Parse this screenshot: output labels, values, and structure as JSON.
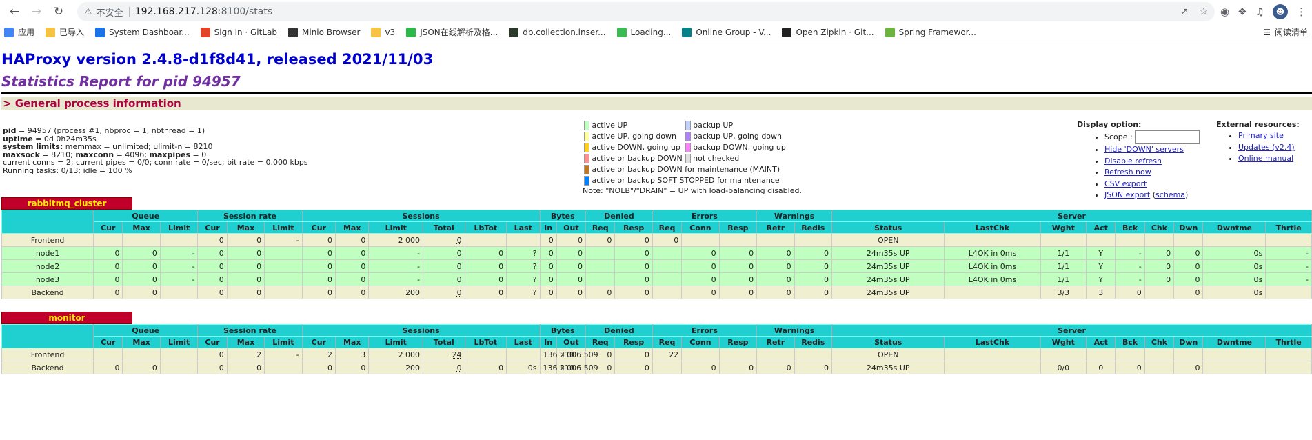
{
  "browser": {
    "insecure_label": "不安全",
    "url_host": "192.168.217.128",
    "url_path": ":8100/stats",
    "bookmarks": [
      {
        "label": "应用",
        "icon": "apps-grid-icon",
        "color": "#4285f4"
      },
      {
        "label": "已导入",
        "icon": "folder-icon",
        "color": "#f6c343"
      },
      {
        "label": "System Dashboar...",
        "icon": "diamond-icon",
        "color": "#1a73e8"
      },
      {
        "label": "Sign in · GitLab",
        "icon": "gitlab-icon",
        "color": "#e24329"
      },
      {
        "label": "Minio Browser",
        "icon": "minio-icon",
        "color": "#333333"
      },
      {
        "label": "v3",
        "icon": "folder-icon",
        "color": "#f6c343"
      },
      {
        "label": "JSON在线解析及格...",
        "icon": "json-icon",
        "color": "#2db84b"
      },
      {
        "label": "db.collection.inser...",
        "icon": "mongo-icon",
        "color": "#2b3a2b"
      },
      {
        "label": "Loading...",
        "icon": "play-icon",
        "color": "#3cba54"
      },
      {
        "label": "Online Group - V...",
        "icon": "sharepoint-icon",
        "color": "#038387"
      },
      {
        "label": "Open Zipkin · Git...",
        "icon": "github-icon",
        "color": "#222222"
      },
      {
        "label": "Spring Framewor...",
        "icon": "spring-icon",
        "color": "#6db33f"
      }
    ],
    "reading_list": "阅读清单"
  },
  "header": {
    "title": "HAProxy version 2.4.8-d1f8d41, released 2021/11/03",
    "subtitle": "Statistics Report for pid 94957",
    "section": "> General process information"
  },
  "info": {
    "pid_label": "pid",
    "pid_value": " = 94957 (process #1, nbproc = 1, nbthread = 1)",
    "uptime_label": "uptime",
    "uptime_value": " = 0d 0h24m35s",
    "limits_label": "system limits:",
    "limits_value": " memmax = unlimited; ulimit-n = 8210",
    "maxsock_label": "maxsock",
    "maxsock_value": " = 8210; ",
    "maxconn_label": "maxconn",
    "maxconn_value": " = 4096; ",
    "maxpipes_label": "maxpipes",
    "maxpipes_value": " = 0",
    "conns": "current conns = 2; current pipes = 0/0; conn rate = 0/sec; bit rate = 0.000 kbps",
    "tasks": "Running tasks: 0/13; idle = 100 %"
  },
  "legend": {
    "items_left": [
      {
        "label": "active UP",
        "color": "#c0ffc0"
      },
      {
        "label": "active UP, going down",
        "color": "#ffffa0"
      },
      {
        "label": "active DOWN, going up",
        "color": "#ffd020"
      },
      {
        "label": "active or backup DOWN",
        "color": "#ff9090"
      },
      {
        "label": "active or backup DOWN for maintenance (MAINT)",
        "color": "#c07820"
      },
      {
        "label": "active or backup SOFT STOPPED for maintenance",
        "color": "#0080ff"
      }
    ],
    "items_right": [
      {
        "label": "backup UP",
        "color": "#c0d0ff"
      },
      {
        "label": "backup UP, going down",
        "color": "#b080ff"
      },
      {
        "label": "backup DOWN, going up",
        "color": "#ff80ff"
      },
      {
        "label": "not checked",
        "color": "#e0e0e0"
      }
    ],
    "note": "Note: \"NOLB\"/\"DRAIN\" = UP with load-balancing disabled."
  },
  "display": {
    "title": "Display option:",
    "scope_label": "Scope :",
    "links": [
      "Hide 'DOWN' servers",
      "Disable refresh",
      "Refresh now",
      "CSV export",
      "JSON export"
    ],
    "schema_label": "schema"
  },
  "external": {
    "title": "External resources:",
    "links": [
      "Primary site",
      "Updates (v2.4)",
      "Online manual"
    ]
  },
  "proxies": [
    {
      "name": "rabbitmq_cluster",
      "groups": [
        "Queue",
        "Session rate",
        "Sessions",
        "Bytes",
        "Denied",
        "Errors",
        "Warnings",
        "Server"
      ],
      "subheaders": [
        "Cur",
        "Max",
        "Limit",
        "Cur",
        "Max",
        "Limit",
        "Cur",
        "Max",
        "Limit",
        "Total",
        "LbTot",
        "Last",
        "In",
        "Out",
        "Req",
        "Resp",
        "Req",
        "Conn",
        "Resp",
        "Retr",
        "Redis",
        "Status",
        "LastChk",
        "Wght",
        "Act",
        "Bck",
        "Chk",
        "Dwn",
        "Dwntme",
        "Thrtle"
      ],
      "rows": [
        {
          "kind": "fe",
          "label": "Frontend",
          "cells": [
            "",
            "",
            "",
            "0",
            "0",
            "-",
            "0",
            "0",
            "2 000",
            "0",
            "",
            "",
            "0",
            "0",
            "0",
            "0",
            "0",
            "",
            "",
            "",
            "",
            "OPEN",
            "",
            "",
            "",
            "",
            "",
            "",
            "",
            ""
          ]
        },
        {
          "kind": "sv",
          "label": "node1",
          "cells": [
            "0",
            "0",
            "-",
            "0",
            "0",
            "",
            "0",
            "0",
            "-",
            "0",
            "0",
            "?",
            "0",
            "0",
            "",
            "0",
            "",
            "0",
            "0",
            "0",
            "0",
            "24m35s UP",
            "L4OK in 0ms",
            "1/1",
            "Y",
            "-",
            "0",
            "0",
            "0s",
            "-"
          ]
        },
        {
          "kind": "sv",
          "label": "node2",
          "cells": [
            "0",
            "0",
            "-",
            "0",
            "0",
            "",
            "0",
            "0",
            "-",
            "0",
            "0",
            "?",
            "0",
            "0",
            "",
            "0",
            "",
            "0",
            "0",
            "0",
            "0",
            "24m35s UP",
            "L4OK in 0ms",
            "1/1",
            "Y",
            "-",
            "0",
            "0",
            "0s",
            "-"
          ]
        },
        {
          "kind": "sv",
          "label": "node3",
          "cells": [
            "0",
            "0",
            "-",
            "0",
            "0",
            "",
            "0",
            "0",
            "-",
            "0",
            "0",
            "?",
            "0",
            "0",
            "",
            "0",
            "",
            "0",
            "0",
            "0",
            "0",
            "24m35s UP",
            "L4OK in 0ms",
            "1/1",
            "Y",
            "-",
            "0",
            "0",
            "0s",
            "-"
          ]
        },
        {
          "kind": "be",
          "label": "Backend",
          "cells": [
            "0",
            "0",
            "",
            "0",
            "0",
            "",
            "0",
            "0",
            "200",
            "0",
            "0",
            "?",
            "0",
            "0",
            "0",
            "0",
            "",
            "0",
            "0",
            "0",
            "0",
            "24m35s UP",
            "",
            "3/3",
            "3",
            "0",
            "",
            "0",
            "0s",
            ""
          ]
        }
      ]
    },
    {
      "name": "monitor",
      "groups": [
        "Queue",
        "Session rate",
        "Sessions",
        "Bytes",
        "Denied",
        "Errors",
        "Warnings",
        "Server"
      ],
      "subheaders": [
        "Cur",
        "Max",
        "Limit",
        "Cur",
        "Max",
        "Limit",
        "Cur",
        "Max",
        "Limit",
        "Total",
        "LbTot",
        "Last",
        "In",
        "Out",
        "Req",
        "Resp",
        "Req",
        "Conn",
        "Resp",
        "Retr",
        "Redis",
        "Status",
        "LastChk",
        "Wght",
        "Act",
        "Bck",
        "Chk",
        "Dwn",
        "Dwntme",
        "Thrtle"
      ],
      "rows": [
        {
          "kind": "fe",
          "label": "Frontend",
          "cells": [
            "",
            "",
            "",
            "0",
            "2",
            "-",
            "2",
            "3",
            "2 000",
            "24",
            "",
            "",
            "136 210",
            "5 006 509",
            "0",
            "0",
            "22",
            "",
            "",
            "",
            "",
            "OPEN",
            "",
            "",
            "",
            "",
            "",
            "",
            "",
            ""
          ]
        },
        {
          "kind": "be",
          "label": "Backend",
          "cells": [
            "0",
            "0",
            "",
            "0",
            "0",
            "",
            "0",
            "0",
            "200",
            "0",
            "0",
            "0s",
            "136 210",
            "5 006 509",
            "0",
            "0",
            "",
            "0",
            "0",
            "0",
            "0",
            "24m35s UP",
            "",
            "0/0",
            "0",
            "0",
            "",
            "0",
            "",
            ""
          ]
        }
      ]
    }
  ]
}
